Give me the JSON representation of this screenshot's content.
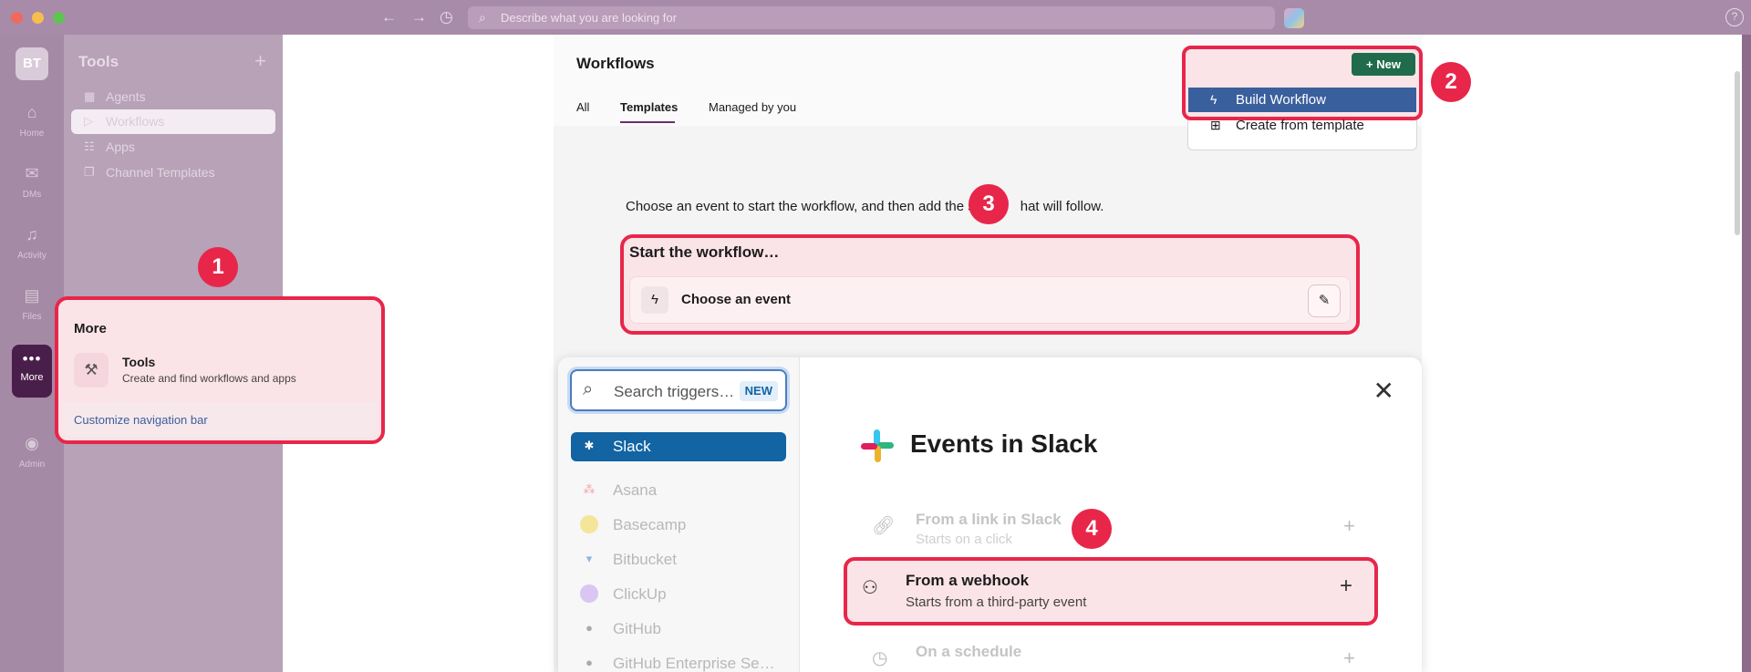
{
  "titlebar": {
    "search_placeholder": "Describe what you are looking for"
  },
  "rail": {
    "workspace_initials": "BT",
    "items": [
      {
        "label": "Home",
        "icon": "home-icon"
      },
      {
        "label": "DMs",
        "icon": "dms-icon"
      },
      {
        "label": "Activity",
        "icon": "bell-icon"
      },
      {
        "label": "Files",
        "icon": "files-icon"
      },
      {
        "label": "More",
        "icon": "more-icon"
      },
      {
        "label": "Admin",
        "icon": "admin-icon"
      }
    ]
  },
  "sidebar": {
    "title": "Tools",
    "items": [
      {
        "label": "Agents"
      },
      {
        "label": "Workflows"
      },
      {
        "label": "Apps"
      },
      {
        "label": "Channel Templates"
      }
    ]
  },
  "more_popover": {
    "title": "More",
    "tools_label": "Tools",
    "tools_desc": "Create and find workflows and apps",
    "customize": "Customize navigation bar"
  },
  "workflows": {
    "title": "Workflows",
    "tabs": [
      "All",
      "Templates",
      "Managed by you"
    ],
    "new_button": "New",
    "menu": {
      "build": "Build Workflow",
      "template": "Create from template"
    },
    "intro": "Choose an event to start the workflow, and then add the s",
    "intro_end": "hat will follow.",
    "start_title": "Start the workflow…",
    "choose_event": "Choose an event"
  },
  "trigger_modal": {
    "search_placeholder": "Search triggers…",
    "new_tag": "NEW",
    "sources": [
      "Slack",
      "Asana",
      "Basecamp",
      "Bitbucket",
      "ClickUp",
      "GitHub",
      "GitHub Enterprise Se…"
    ],
    "heading": "Events in Slack",
    "events": [
      {
        "title": "From a link in Slack",
        "subtitle": "Starts on a click"
      },
      {
        "title": "From a webhook",
        "subtitle": "Starts from a third-party event"
      },
      {
        "title": "On a schedule",
        "subtitle": ""
      }
    ]
  },
  "badges": [
    "1",
    "2",
    "3",
    "4"
  ],
  "colors": {
    "callout": "#e8264a",
    "new_button": "#1f6b4b",
    "slack_blue": "#1264a3"
  }
}
